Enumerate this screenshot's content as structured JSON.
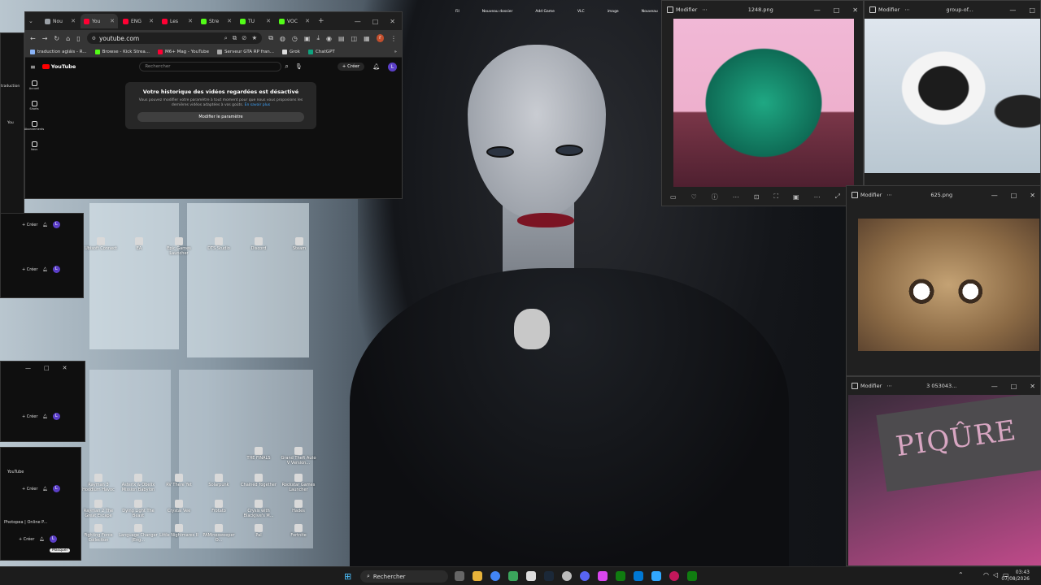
{
  "browser": {
    "tabs": [
      {
        "label": "Nou",
        "color": "#9aa0a6"
      },
      {
        "label": "You",
        "color": "#ff0033",
        "active": true
      },
      {
        "label": "ENG",
        "color": "#ff0033"
      },
      {
        "label": "Les",
        "color": "#ff0033"
      },
      {
        "label": "Stre",
        "color": "#53fc18"
      },
      {
        "label": "TU",
        "color": "#53fc18"
      },
      {
        "label": "VOC",
        "color": "#53fc18"
      }
    ],
    "url": "youtube.com",
    "avatar_letter": "r",
    "bookmarks": [
      {
        "label": "traduction agláis - R...",
        "color": "#8ab4f8"
      },
      {
        "label": "Browse - Kick Strea...",
        "color": "#53fc18"
      },
      {
        "label": "M6+ Mag - YouTube",
        "color": "#ff0033"
      },
      {
        "label": "Serveur GTA RP fran...",
        "color": "#aaaaaa"
      },
      {
        "label": "Grok",
        "color": "#dddddd"
      },
      {
        "label": "ChatGPT",
        "color": "#10a37f"
      }
    ],
    "youtube": {
      "logo": "YouTube",
      "search_placeholder": "Rechercher",
      "create_label": "Créer",
      "avatar_letter": "L",
      "sidebar": [
        "Accueil",
        "Shorts",
        "Abonnements",
        "Vous"
      ],
      "history_title": "Votre historique des vidéos regardées est désactivé",
      "history_text": "Vous pouvez modifier votre paramètre à tout moment pour que nous vous proposions les dernières vidéos adaptées à vos goûts.",
      "learn_more": "En savoir plus",
      "history_button": "Modifier le paramètre"
    }
  },
  "viewers": {
    "edit_label": "Modifier",
    "frog": {
      "title": "1248.png"
    },
    "penguins": {
      "title": "group-of..."
    },
    "eyes": {
      "title": "625.png"
    },
    "piqure": {
      "title": "3 053043...",
      "sign_text": "PIQÛRE"
    }
  },
  "desktop_icons_top": [
    "Ubisoft Connect",
    "EA",
    "Epic Games Launcher",
    "DTS Studio",
    "Discord",
    "Steam"
  ],
  "desktop_icons_grid": [
    [
      "THE FINALS",
      "Grand Theft Auto V Version..."
    ],
    [
      "Rayman 3 Hoodlum Havoc",
      "Asterix & Obelix Mission Babylon",
      "RV There Yet",
      "Solarpunk",
      "Chained Together",
      "Rockstar Games Launcher"
    ],
    [
      "Rayman 2 The Great Escape",
      "Dying Light The Beast",
      "Crystal Vee",
      "Frotato",
      "Crysis with Blackjive's M...",
      "Hades"
    ],
    [
      "Fighting Force Collection",
      "Language Changer (Eng...",
      "Little Nightmares II",
      "PAMinesweeper O...",
      "Pal",
      "Fortnite"
    ]
  ],
  "left_windows": {
    "labels": [
      "traduction",
      "You",
      "YouTube",
      "Photopea | Online P..."
    ],
    "create_label": "Créer",
    "avatar_letter": "L",
    "misc_button": "Masquer"
  },
  "taskbar": {
    "search_label": "Rechercher",
    "time": "03:43",
    "date": "07/08/2026"
  }
}
